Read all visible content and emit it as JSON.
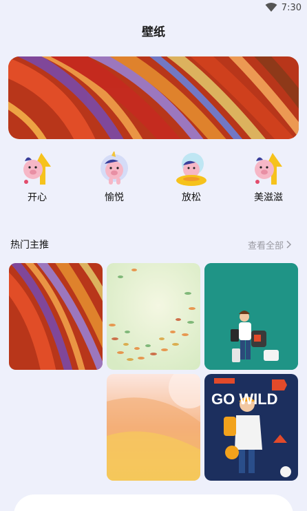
{
  "status_bar": {
    "time": "7:30"
  },
  "header": {
    "title": "壁纸"
  },
  "categories": [
    {
      "label": "开心",
      "icon": "pig-bunny-balloon-icon"
    },
    {
      "label": "愉悦",
      "icon": "pig-unicorn-icon"
    },
    {
      "label": "放松",
      "icon": "pig-swim-ring-icon"
    },
    {
      "label": "美滋滋",
      "icon": "pig-bunny-balloon-icon"
    }
  ],
  "section": {
    "title": "热门主推",
    "see_all": "查看全部"
  },
  "tiles": [
    {
      "name": "wallpaper-ribbons"
    },
    {
      "name": "wallpaper-fish-swirl"
    },
    {
      "name": "wallpaper-traveler"
    },
    {
      "name": "wallpaper-orange-gradient"
    },
    {
      "name": "wallpaper-go-wild",
      "text": "GO WILD"
    }
  ],
  "colors": {
    "background": "#eef0fb",
    "teal_tile": "#1f9486",
    "navy_tile": "#1c2f5e"
  }
}
